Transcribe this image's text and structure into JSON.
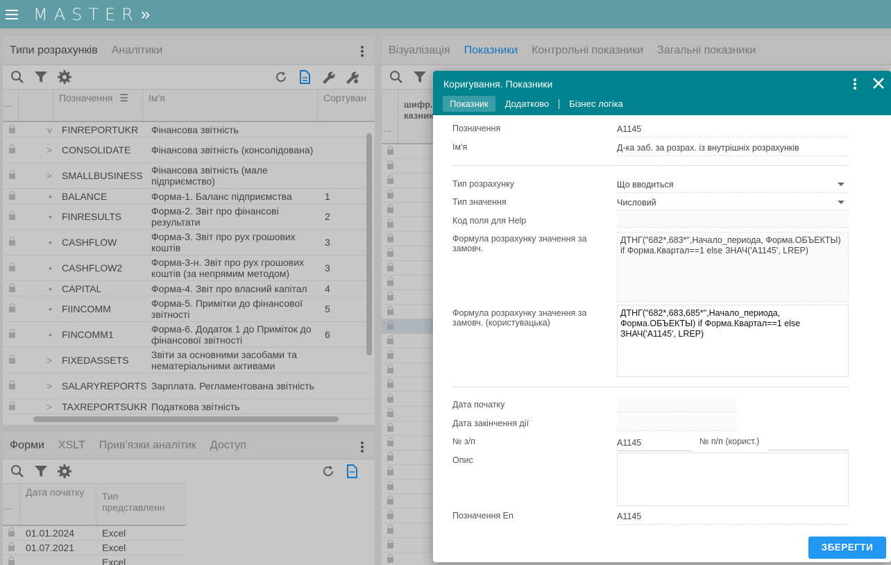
{
  "app": {
    "title": "MASTER",
    "chevron": "»"
  },
  "left_top": {
    "tabs": [
      "Типи розрахунків",
      "Аналітики"
    ],
    "columns": {
      "dots": "...",
      "designation": "Позначення",
      "name": "Ім'я",
      "sort": "Сортуван"
    },
    "rows": [
      {
        "code": "FINREPORTUKR",
        "name": "Фінансова звітність",
        "sort": "",
        "tree": "v"
      },
      {
        "code": "CONSOLIDATE",
        "name": "Фінансова звітність (консолідована)",
        "sort": "",
        "tree": ">"
      },
      {
        "code": "SMALLBUSINESS",
        "name": "Фінансова звітність (мале підприємство)",
        "sort": "",
        "tree": ">"
      },
      {
        "code": "BALANCE",
        "name": "Форма-1. Баланс підприємства",
        "sort": "1",
        "tree": "•"
      },
      {
        "code": "FINRESULTS",
        "name": "Форма-2. Звіт про фінансові результати",
        "sort": "2",
        "tree": "•"
      },
      {
        "code": "CASHFLOW",
        "name": "Форма-3. Звіт про рух грошових коштів",
        "sort": "3",
        "tree": "•"
      },
      {
        "code": "CASHFLOW2",
        "name": "Форма-3-н. Звіт про рух грошових коштів (за непрямим методом)",
        "sort": "3",
        "tree": "•"
      },
      {
        "code": "CAPITAL",
        "name": "Форма-4. Звіт про власний капітал",
        "sort": "4",
        "tree": "•"
      },
      {
        "code": "FIINCOMM",
        "name": "Форма-5. Примітки до фінансової звітності",
        "sort": "5",
        "tree": "•"
      },
      {
        "code": "FINCOMM1",
        "name": "Форма-6. Додаток 1 до Приміток до фінансової звітності",
        "sort": "6",
        "tree": "•"
      },
      {
        "code": "FIXEDASSETS",
        "name": "Звіти за основними засобами та нематеріальними активами",
        "sort": "",
        "tree": ">"
      },
      {
        "code": "SALARYREPORTS",
        "name": "Зарплата. Регламентована звітність",
        "sort": "",
        "tree": ">"
      },
      {
        "code": "TAXREPORTSUKR",
        "name": "Податкова звітність",
        "sort": "",
        "tree": ">"
      }
    ]
  },
  "left_bottom": {
    "tabs": [
      "Форми",
      "XSLT",
      "Прив'язки аналітик",
      "Доступ"
    ],
    "columns": {
      "dots": "...",
      "start_date": "Дата початку",
      "type": "Тип представленн"
    },
    "rows": [
      {
        "date": "01.01.2024",
        "type": "Excel"
      },
      {
        "date": "01.07.2021",
        "type": "Excel"
      },
      {
        "date": "",
        "type": "Excel"
      }
    ]
  },
  "right": {
    "tabs": [
      "Візуалізація",
      "Показники",
      "Контрольні показники",
      "Загальні показники"
    ],
    "col_header": "шифр. казник",
    "dots": "..."
  },
  "dialog": {
    "title": "Коригування. Показники",
    "tabs": [
      "Показник",
      "Додатково",
      "Бізнес логіка"
    ],
    "fields": {
      "designation_label": "Позначення",
      "designation": "A1145",
      "name_label": "Ім'я",
      "name": "Д-ка заб. за розрах. із внутрішніх розрахунків",
      "calc_type_label": "Тип розрахунку",
      "calc_type": "Що вводиться",
      "value_type_label": "Тип значення",
      "value_type": "Числовий",
      "help_label": "Код поля для Help",
      "help": "",
      "formula_label": "Формула розрахунку значення за замовч.",
      "formula": "ДТНГ(\"682*,683*\",Начало_периода, Форма.ОБЪЕКТЫ) if Форма.Квартал==1 else ЗНАЧ('A1145', LREP)",
      "formula_user_label": "Формула розрахунку значення за замовч. (користувацька)",
      "formula_user": "ДТНГ(\"682*,683,685*\",Начало_периода, Форма.ОБЪЕКТЫ) if Форма.Квартал==1 else ЗНАЧ('A1145', LREP)",
      "start_date_label": "Дата початку",
      "end_date_label": "Дата закінчення дії",
      "num_label": "№ з/п",
      "num": "A1145",
      "num_user_label": "№ п/п (корист.)",
      "num_user": "",
      "desc_label": "Опис",
      "desc": "",
      "designation_en_label": "Позначення En",
      "designation_en": "A1145"
    },
    "save_label": "ЗБЕРЕГТИ"
  }
}
